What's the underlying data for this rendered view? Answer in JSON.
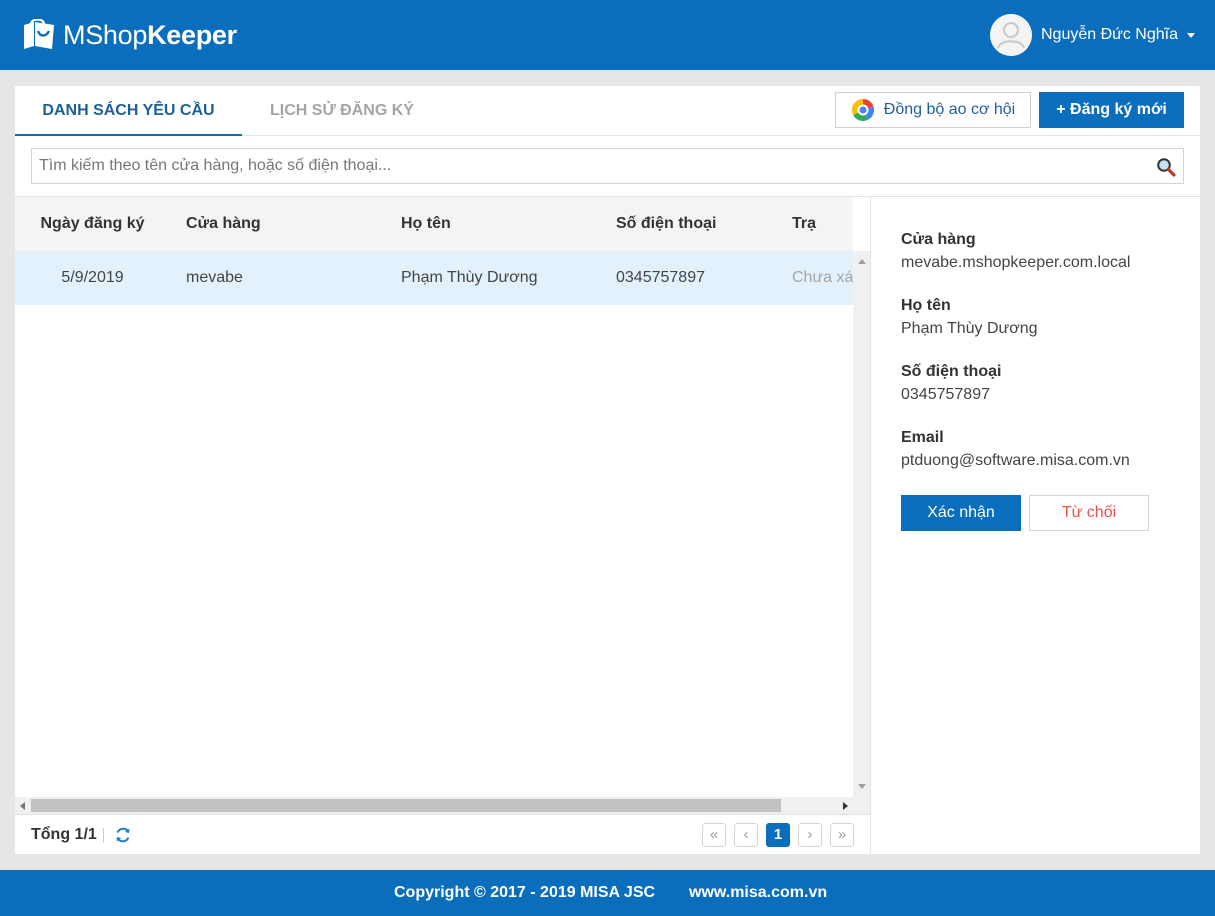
{
  "app": {
    "logo_part1": "MShop",
    "logo_part2": "Keeper",
    "user_name": "Nguyễn Đức Nghĩa"
  },
  "tabs": [
    {
      "label": "DANH SÁCH YÊU CẦU",
      "active": true
    },
    {
      "label": "LỊCH SỬ ĐĂNG KÝ",
      "active": false
    }
  ],
  "toolbar": {
    "sync_label": "Đồng bộ ao cơ hội",
    "new_label": "+ Đăng ký mới"
  },
  "search": {
    "placeholder": "Tìm kiếm theo tên cửa hàng, hoặc số điện thoại...",
    "value": ""
  },
  "table": {
    "columns": [
      "Ngày đăng ký",
      "Cửa hàng",
      "Họ tên",
      "Số điện thoại",
      "Trạng thái"
    ],
    "columns_visible": [
      "Ngày đăng ký",
      "Cửa hàng",
      "Họ tên",
      "Số điện thoại",
      "Trạ"
    ],
    "rows": [
      {
        "date": "5/9/2019",
        "store": "mevabe",
        "name": "Phạm Thùy Dương",
        "phone": "0345757897",
        "status_visible": "Chưa xác"
      }
    ],
    "selected_row": 0
  },
  "pagination": {
    "total_label": "Tổng 1/1",
    "first": "«",
    "prev": "‹",
    "current": "1",
    "next": "›",
    "last": "»"
  },
  "detail": {
    "store_label": "Cửa hàng",
    "store_value": "mevabe.mshopkeeper.com.local",
    "name_label": "Họ tên",
    "name_value": "Phạm Thùy Dương",
    "phone_label": "Số điện thoại",
    "phone_value": "0345757897",
    "email_label": "Email",
    "email_value": "ptduong@software.misa.com.vn",
    "confirm_label": "Xác nhận",
    "reject_label": "Từ chối"
  },
  "footer": {
    "copyright": "Copyright © 2017 - 2019 MISA JSC",
    "website": "www.misa.com.vn"
  },
  "colors": {
    "brand_blue": "#0a6ebd",
    "selected_row": "#e3f1fc",
    "reject_text": "#e8524a",
    "tab_active_text": "#1f5f99",
    "tab_inactive_text": "#a4a4a4"
  },
  "icons": [
    "shopping-bag-logo-icon",
    "user-avatar-icon",
    "dropdown-caret-icon",
    "google-sync-icon",
    "search-icon",
    "refresh-icon"
  ]
}
